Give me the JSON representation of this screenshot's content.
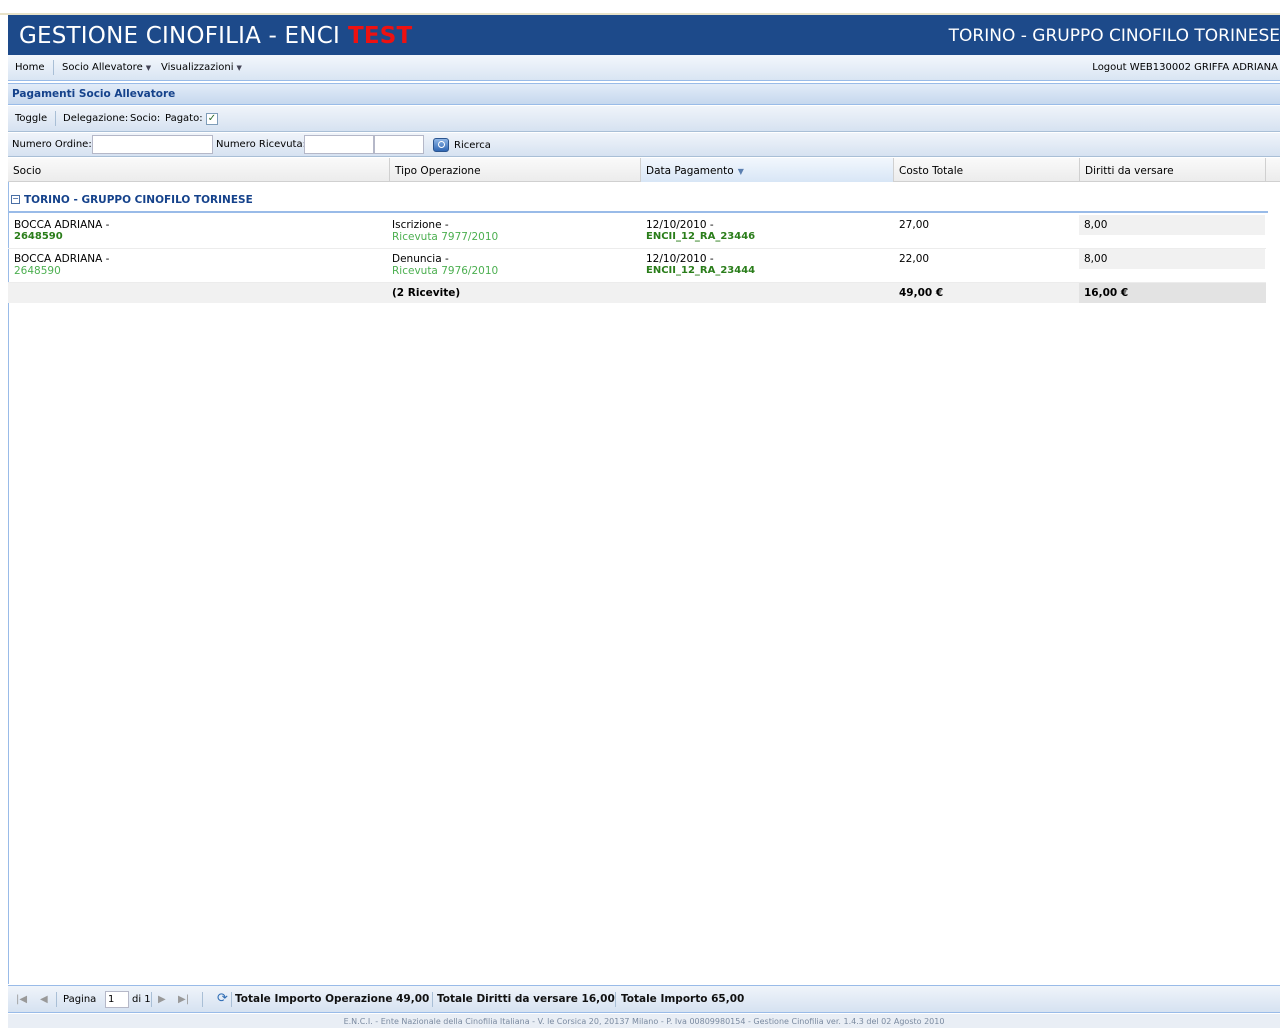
{
  "header": {
    "app_title": "GESTIONE CINOFILIA - ENCI",
    "env_badge": "TEST",
    "org_title": "TORINO - GRUPPO CINOFILO TORINESE"
  },
  "menu": {
    "home": "Home",
    "socio": "Socio Allevatore",
    "visualizzazioni": "Visualizzazioni",
    "logout": "Logout WEB130002 GRIFFA ADRIANA"
  },
  "panel": {
    "title": "Pagamenti Socio Allevatore"
  },
  "filters": {
    "toggle": "Toggle",
    "delegazione": "Delegazione:",
    "socio": "Socio:",
    "pagato": "Pagato:",
    "pagato_checked": "✓",
    "numero_ordine_label": "Numero Ordine:",
    "numero_ordine_value": "",
    "numero_ricevuta_label": "Numero Ricevuta:",
    "numero_ricevuta_value1": "",
    "numero_ricevuta_value2": "",
    "search": "Ricerca"
  },
  "grid": {
    "columns": [
      "Socio",
      "Tipo Operazione",
      "Data Pagamento",
      "Costo Totale",
      "Diritti da versare"
    ],
    "sort_indicator": "▼",
    "group_label": "TORINO - GRUPPO CINOFILO TORINESE",
    "group_toggle": "−",
    "rows": [
      {
        "socio_name": "BOCCA ADRIANA -",
        "socio_code": "2648590",
        "op_type": "Iscrizione -",
        "receipt": "Ricevuta 7977/2010",
        "date": "12/10/2010 -",
        "order": "ENCII_12_RA_23446",
        "cost": "27,00",
        "rights": "8,00"
      },
      {
        "socio_name": "BOCCA ADRIANA -",
        "socio_code": "2648590",
        "op_type": "Denuncia -",
        "receipt": "Ricevuta 7976/2010",
        "date": "12/10/2010 -",
        "order": "ENCII_12_RA_23444",
        "cost": "22,00",
        "rights": "8,00"
      }
    ],
    "summary": {
      "count": "(2 Ricevite)",
      "cost": "49,00 €",
      "rights": "16,00 €"
    }
  },
  "paging": {
    "page_label": "Pagina",
    "page_value": "1",
    "of_label": "di 1",
    "total_op_label": "Totale Importo Operazione",
    "total_op_value": "49,00",
    "total_rights_label": "Totale Diritti da versare",
    "total_rights_value": "16,00",
    "total_label": "Totale Importo",
    "total_value": "65,00"
  },
  "footer": {
    "text": "E.N.C.I. - Ente Nazionale della Cinofilia Italiana - V. le Corsica 20, 20137 Milano - P. Iva 00809980154 - Gestione Cinofilia ver. 1.4.3 del 02 Agosto 2010"
  }
}
